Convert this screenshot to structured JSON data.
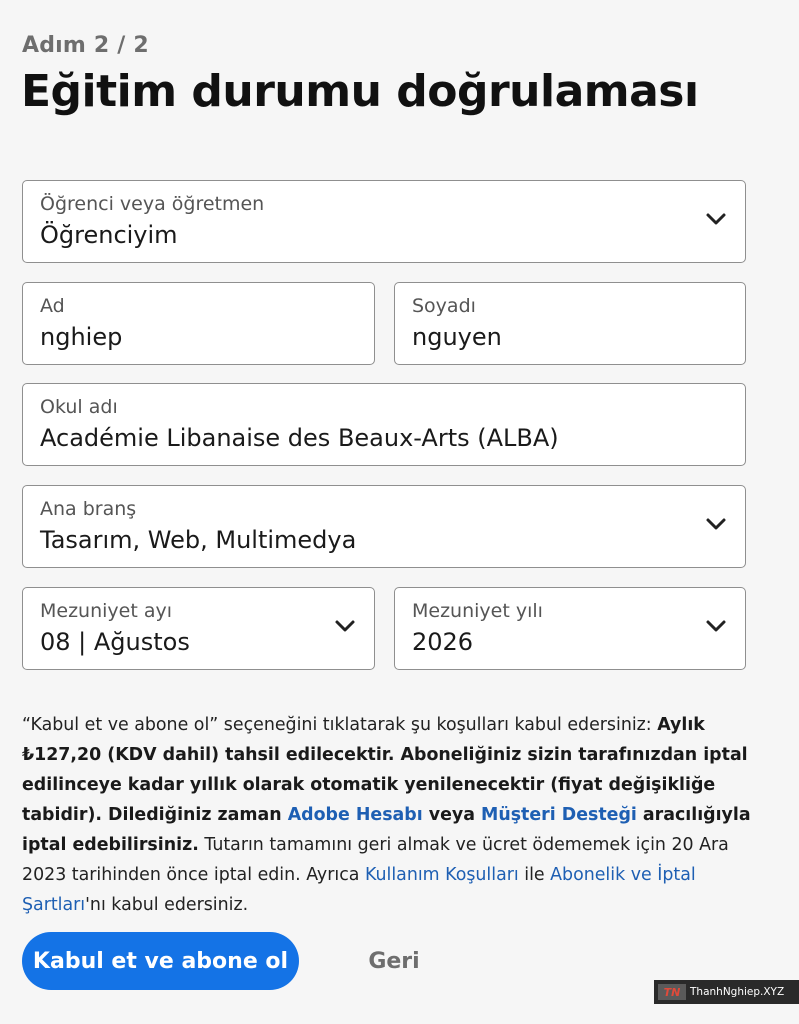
{
  "header": {
    "step": "Adım 2 / 2",
    "title": "Eğitim durumu doğrulaması"
  },
  "form": {
    "role": {
      "label": "Öğrenci veya öğretmen",
      "value": "Öğrenciyim",
      "icon": "chevron-down-icon"
    },
    "first_name": {
      "label": "Ad",
      "value": "nghiep"
    },
    "last_name": {
      "label": "Soyadı",
      "value": "nguyen"
    },
    "school": {
      "label": "Okul adı",
      "value": "Académie Libanaise des Beaux-Arts (ALBA)"
    },
    "major": {
      "label": "Ana branş",
      "value": "Tasarım, Web, Multimedya",
      "icon": "chevron-down-icon"
    },
    "grad_month": {
      "label": "Mezuniyet ayı",
      "value": "08 | Ağustos",
      "icon": "chevron-down-icon"
    },
    "grad_year": {
      "label": "Mezuniyet yılı",
      "value": "2026",
      "icon": "chevron-down-icon"
    }
  },
  "terms": {
    "t1": "“Kabul et ve abone ol” seçeneğini tıklatarak şu koşulları kabul edersiniz: ",
    "t2": "Aylık ₺127,20 (KDV dahil) tahsil edilecektir. Aboneliğiniz sizin tarafınızdan iptal edilinceye kadar yıllık olarak otomatik yenilenecektir (fiyat değişikliğe tabidir). Dilediğiniz zaman ",
    "link_account": "Adobe Hesabı",
    "t3": " veya ",
    "link_support": "Müşteri Desteği",
    "t4": " aracılığıyla iptal edebilirsiniz.",
    "t5": " Tutarın tamamını geri almak ve ücret ödememek için 20 Ara 2023 tarihinden önce iptal edin. Ayrıca ",
    "link_terms_of_use": "Kullanım Koşulları",
    "t6": " ile ",
    "link_subscription_terms": "Abonelik ve İptal Şartları",
    "t7": "'nı kabul edersiniz."
  },
  "actions": {
    "accept_label": "Kabul et ve abone ol",
    "back_label": "Geri"
  },
  "watermark": {
    "logo": "TN",
    "text": "ThanhNghiep.XYZ"
  },
  "colors": {
    "primary": "#1473e6",
    "link": "#1e5fb3",
    "background": "#f6f6f6"
  }
}
